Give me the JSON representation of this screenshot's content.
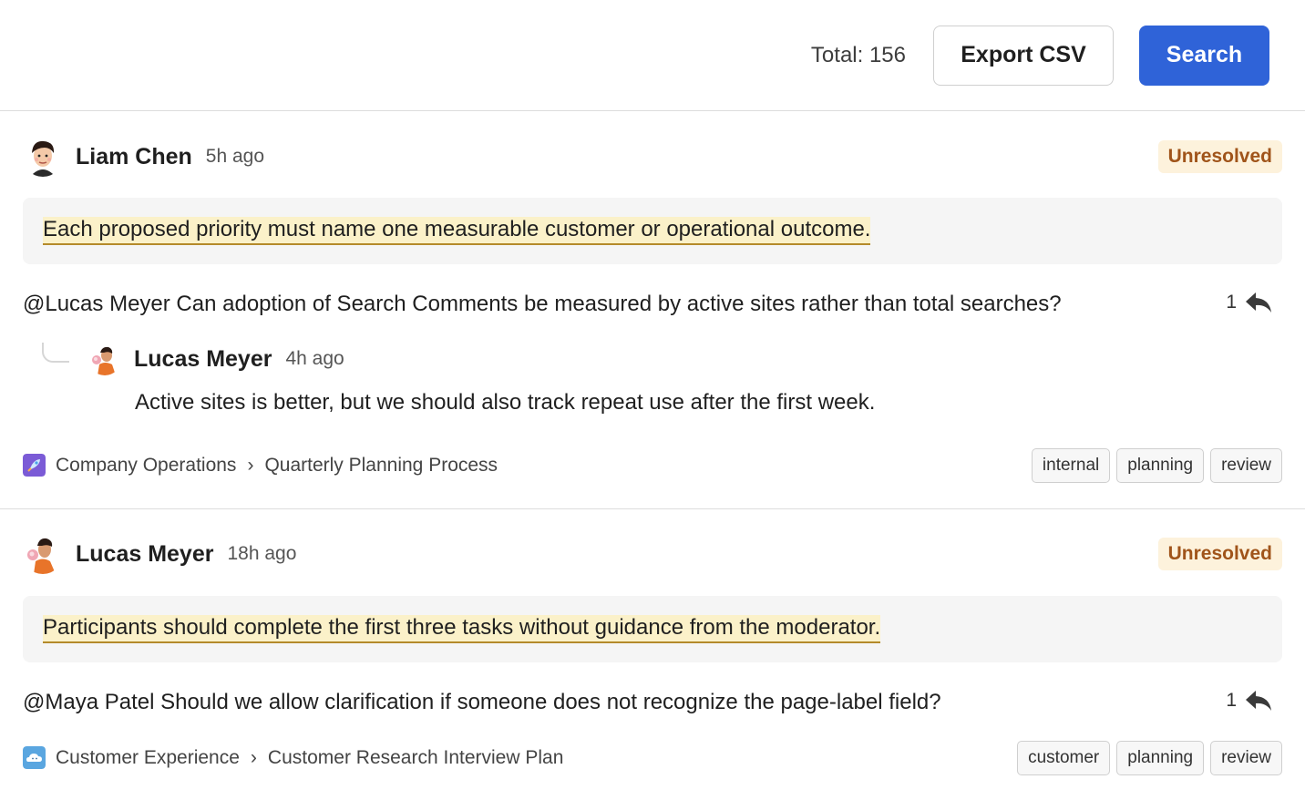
{
  "toolbar": {
    "total_label": "Total: 156",
    "export_label": "Export CSV",
    "search_label": "Search"
  },
  "colors": {
    "primary": "#2f63d8",
    "badge_bg": "#fdf2dc",
    "badge_text": "#a0541a",
    "highlight": "#fbf1c9"
  },
  "threads": [
    {
      "author": "Liam Chen",
      "time": "5h ago",
      "status": "Unresolved",
      "quote": "Each proposed priority must name one measurable customer or operational outcome.",
      "comment": "@Lucas Meyer Can adoption of Search Comments be measured by active sites rather than total searches?",
      "reply_count": "1",
      "replies": [
        {
          "author": "Lucas Meyer",
          "time": "4h ago",
          "text": "Active sites is better, but we should also track repeat use after the first week."
        }
      ],
      "space": "Company Operations",
      "page": "Quarterly Planning Process",
      "tags": [
        "internal",
        "planning",
        "review"
      ]
    },
    {
      "author": "Lucas Meyer",
      "time": "18h ago",
      "status": "Unresolved",
      "quote": "Participants should complete the first three tasks without guidance from the moderator.",
      "comment": "@Maya Patel Should we allow clarification if someone does not recognize the page-label field?",
      "reply_count": "1",
      "space": "Customer Experience",
      "page": "Customer Research Interview Plan",
      "tags": [
        "customer",
        "planning",
        "review"
      ]
    }
  ],
  "icons": {
    "reply": "reply-arrow-icon",
    "breadcrumb_separator": "chevron-right-icon",
    "space_1": "rocket-space-icon",
    "space_2": "cloud-space-icon"
  }
}
